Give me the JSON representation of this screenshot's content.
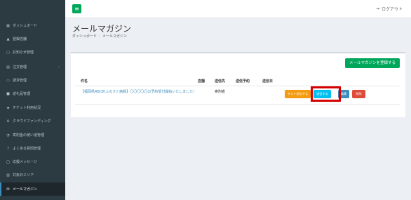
{
  "topbar": {
    "menu_icon": "hamburger-icon",
    "logout_label": "ログアウト",
    "logout_icon": "logout-icon"
  },
  "sidebar": {
    "items": [
      {
        "label": "ダッシュボード",
        "icon": "dashboard-icon",
        "glyph": "▦"
      },
      {
        "label": "登録店舗",
        "icon": "store-icon",
        "glyph": "▲"
      },
      {
        "label": "お知らせ管理",
        "icon": "notice-icon",
        "glyph": "▢"
      },
      {
        "label": "注文管理",
        "icon": "order-icon",
        "glyph": "▤",
        "chevron": "‹"
      },
      {
        "label": "請求管理",
        "icon": "invoice-icon",
        "glyph": "▭"
      },
      {
        "label": "返礼品管理",
        "icon": "gift-icon",
        "glyph": "■"
      },
      {
        "label": "チケット利用状況",
        "icon": "ticket-icon",
        "glyph": "◈"
      },
      {
        "label": "クラウドファンディング",
        "icon": "crowdfunding-icon",
        "glyph": "⊖"
      },
      {
        "label": "寄附金の使い道管理",
        "icon": "usage-icon",
        "glyph": "◔"
      },
      {
        "label": "よくある質問管理",
        "icon": "faq-icon",
        "glyph": "?"
      },
      {
        "label": "応援メッセージ",
        "icon": "message-icon",
        "glyph": "◯"
      },
      {
        "label": "対象外エリア",
        "icon": "area-icon",
        "glyph": "▥"
      },
      {
        "label": "メールマガジン",
        "icon": "mail-icon",
        "glyph": "✉",
        "active": true
      }
    ]
  },
  "page": {
    "title": "メールマガジン",
    "breadcrumb": [
      "ダッシュボード",
      "メールマガジン"
    ],
    "breadcrumb_sep": "›"
  },
  "box": {
    "register_button": "メールマガジンを登録する",
    "columns": {
      "name": "件名",
      "store": "店舗",
      "recipients": "送信先",
      "scheduled": "送信予約",
      "sent": "送信日"
    },
    "rows": [
      {
        "name": "【福岡県ABC町ふるさと納税】〇〇〇〇〇の予約受付開始いたしました！",
        "store": "",
        "recipients": "寄附者",
        "scheduled": "",
        "sent": "",
        "actions": {
          "test_send": "テスト送信する",
          "send": "送信する",
          "edit": "編集",
          "delete": "削除"
        }
      }
    ]
  },
  "colors": {
    "sidebar_bg": "#2c3b41",
    "green": "#00a65a",
    "orange": "#f39c12",
    "cyan": "#00c0ef",
    "blue": "#3c8dbc",
    "red": "#dd4b39",
    "highlight": "#d50000"
  }
}
